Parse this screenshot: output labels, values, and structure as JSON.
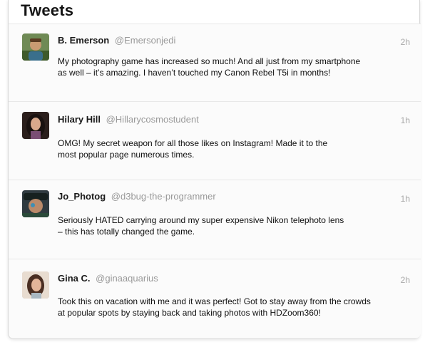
{
  "section": {
    "title": "Tweets"
  },
  "tweets": [
    {
      "name": "B. Emerson",
      "handle": "@Emersonjedi",
      "time": "2h",
      "line1": "My photography game has increased so much! And all just from my smartphone",
      "line2": "as well – it’s amazing. I haven’t touched my Canon Rebel T5i in months!"
    },
    {
      "name": "Hilary Hill",
      "handle": "@Hillarycosmostudent",
      "time": "1h",
      "line1": "OMG! My secret weapon for all those likes on Instagram! Made it to the",
      "line2": "most popular page numerous times."
    },
    {
      "name": "Jo_Photog",
      "handle": "@d3bug-the-programmer",
      "time": "1h",
      "line1": "Seriously HATED carrying around my super expensive Nikon telephoto lens",
      "line2": "– this has totally changed the game."
    },
    {
      "name": "Gina C.",
      "handle": "@ginaaquarius",
      "time": "2h",
      "line1": "Took this on vacation with me and it was perfect! Got to stay away from the crowds",
      "line2": "at popular spots by staying back and taking photos with HDZoom360!"
    }
  ]
}
